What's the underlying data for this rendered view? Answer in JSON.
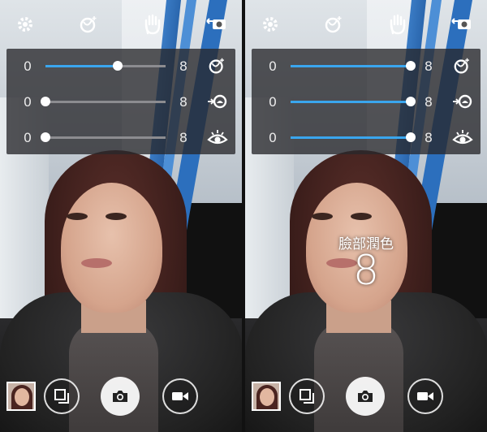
{
  "screens": [
    {
      "id": "left",
      "sliders": [
        {
          "min": "0",
          "max": "8",
          "value": 4.8,
          "icon": "face-retouch-icon"
        },
        {
          "min": "0",
          "max": "8",
          "value": 0,
          "icon": "skin-smooth-icon"
        },
        {
          "min": "0",
          "max": "8",
          "value": 0,
          "icon": "eye-enlarge-icon"
        }
      ],
      "overlay": null
    },
    {
      "id": "right",
      "sliders": [
        {
          "min": "0",
          "max": "8",
          "value": 8,
          "icon": "face-retouch-icon"
        },
        {
          "min": "0",
          "max": "8",
          "value": 8,
          "icon": "skin-smooth-icon"
        },
        {
          "min": "0",
          "max": "8",
          "value": 8,
          "icon": "eye-enlarge-icon"
        }
      ],
      "overlay": {
        "label": "臉部潤色",
        "value": "8"
      }
    }
  ],
  "colors": {
    "accent": "#3aa6ee",
    "track": "#8c8c90",
    "panel": "rgba(40,40,44,0.78)"
  },
  "topbar_icons": [
    "gear-icon",
    "face-beautify-icon",
    "hand-gesture-icon",
    "switch-camera-icon"
  ],
  "bottombar_icons": [
    "gallery-thumbnail",
    "gallery-icon",
    "camera-shutter-icon",
    "video-icon"
  ]
}
